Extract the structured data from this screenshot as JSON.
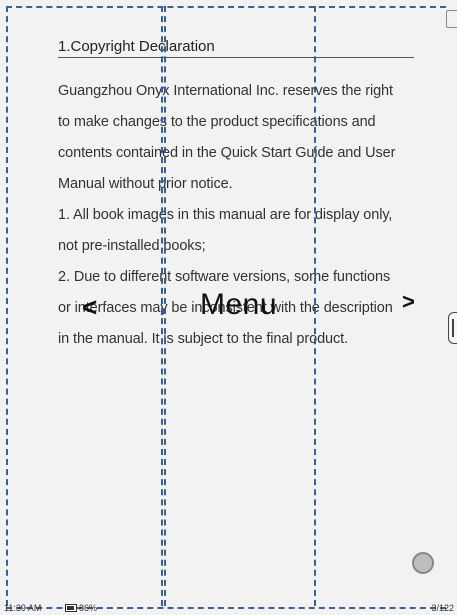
{
  "document": {
    "heading": "1.Copyright Declaration",
    "lines": [
      "Guangzhou Onyx International Inc. reserves the right",
      "to make changes to the product specifications and",
      "contents contained in the Quick Start Guide and User",
      "Manual without prior notice.",
      "1. All book images in this manual are for display only,",
      "not pre-installed books;",
      "2. Due to different software versions, some functions",
      "or interfaces may be inconsistent with the description",
      "in the manual. It is subject to the final product."
    ]
  },
  "overlay": {
    "prev_label": "<",
    "menu_label": "Menu",
    "next_label": ">"
  },
  "status": {
    "time": "11:39 AM",
    "battery": "86%",
    "page": "3/122"
  },
  "icons": {
    "bookmark": "bookmark-icon",
    "side_handle": "side-handle-icon",
    "float_button": "floating-circle-button",
    "battery": "battery-icon"
  },
  "colors": {
    "zone_lines": "#3a5f9a",
    "background": "#f2f2f2"
  }
}
